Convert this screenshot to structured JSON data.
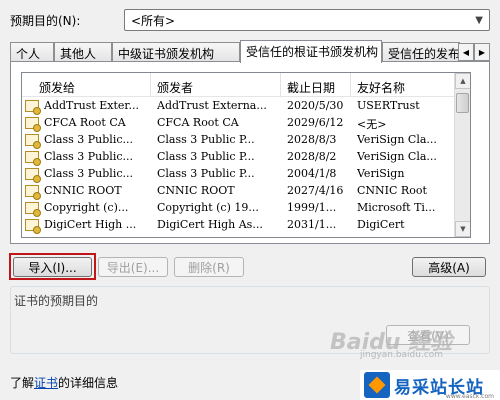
{
  "purpose": {
    "label": "预期目的(N):",
    "selected": "<所有>"
  },
  "tabs": [
    {
      "label": "个人"
    },
    {
      "label": "其他人"
    },
    {
      "label": "中级证书颁发机构"
    },
    {
      "label": "受信任的根证书颁发机构"
    },
    {
      "label": "受信任的发布者"
    }
  ],
  "active_tab": "受信任的根证书颁发机构",
  "table": {
    "columns": [
      "颁发给",
      "颁发者",
      "截止日期",
      "友好名称"
    ],
    "rows": [
      {
        "issued_to": "AddTrust Exter...",
        "issued_by": "AddTrust Externa...",
        "expires": "2020/5/30",
        "friendly": "USERTrust"
      },
      {
        "issued_to": "CFCA Root CA",
        "issued_by": "CFCA Root CA",
        "expires": "2029/6/12",
        "friendly": "<无>"
      },
      {
        "issued_to": "Class 3 Public...",
        "issued_by": "Class 3 Public P...",
        "expires": "2028/8/3",
        "friendly": "VeriSign Cla..."
      },
      {
        "issued_to": "Class 3 Public...",
        "issued_by": "Class 3 Public P...",
        "expires": "2028/8/2",
        "friendly": "VeriSign Cla..."
      },
      {
        "issued_to": "Class 3 Public...",
        "issued_by": "Class 3 Public P...",
        "expires": "2004/1/8",
        "friendly": "VeriSign"
      },
      {
        "issued_to": "CNNIC ROOT",
        "issued_by": "CNNIC ROOT",
        "expires": "2027/4/16",
        "friendly": "CNNIC Root"
      },
      {
        "issued_to": "Copyright (c)...",
        "issued_by": "Copyright (c) 19...",
        "expires": "1999/1...",
        "friendly": "Microsoft Ti..."
      },
      {
        "issued_to": "DigiCert High ...",
        "issued_by": "DigiCert High As...",
        "expires": "2031/1...",
        "friendly": "DigiCert"
      }
    ]
  },
  "buttons": {
    "import": "导入(I)...",
    "export": "导出(E)...",
    "delete": "删除(R)",
    "advanced": "高级(A)",
    "view": "查看(V)"
  },
  "group": {
    "label": "证书的预期目的"
  },
  "footer": {
    "prefix": "了解",
    "link": "证书",
    "suffix": "的详细信息"
  },
  "watermark": {
    "baidu": "Baidu 经验",
    "url": "jingyan.baidu.com"
  },
  "site_logo": {
    "name": "易采站长站",
    "sub": "www.easck.com"
  },
  "colors": {
    "highlight": "#c0161a",
    "link": "#0645ad",
    "logo_blue": "#1565c0"
  }
}
